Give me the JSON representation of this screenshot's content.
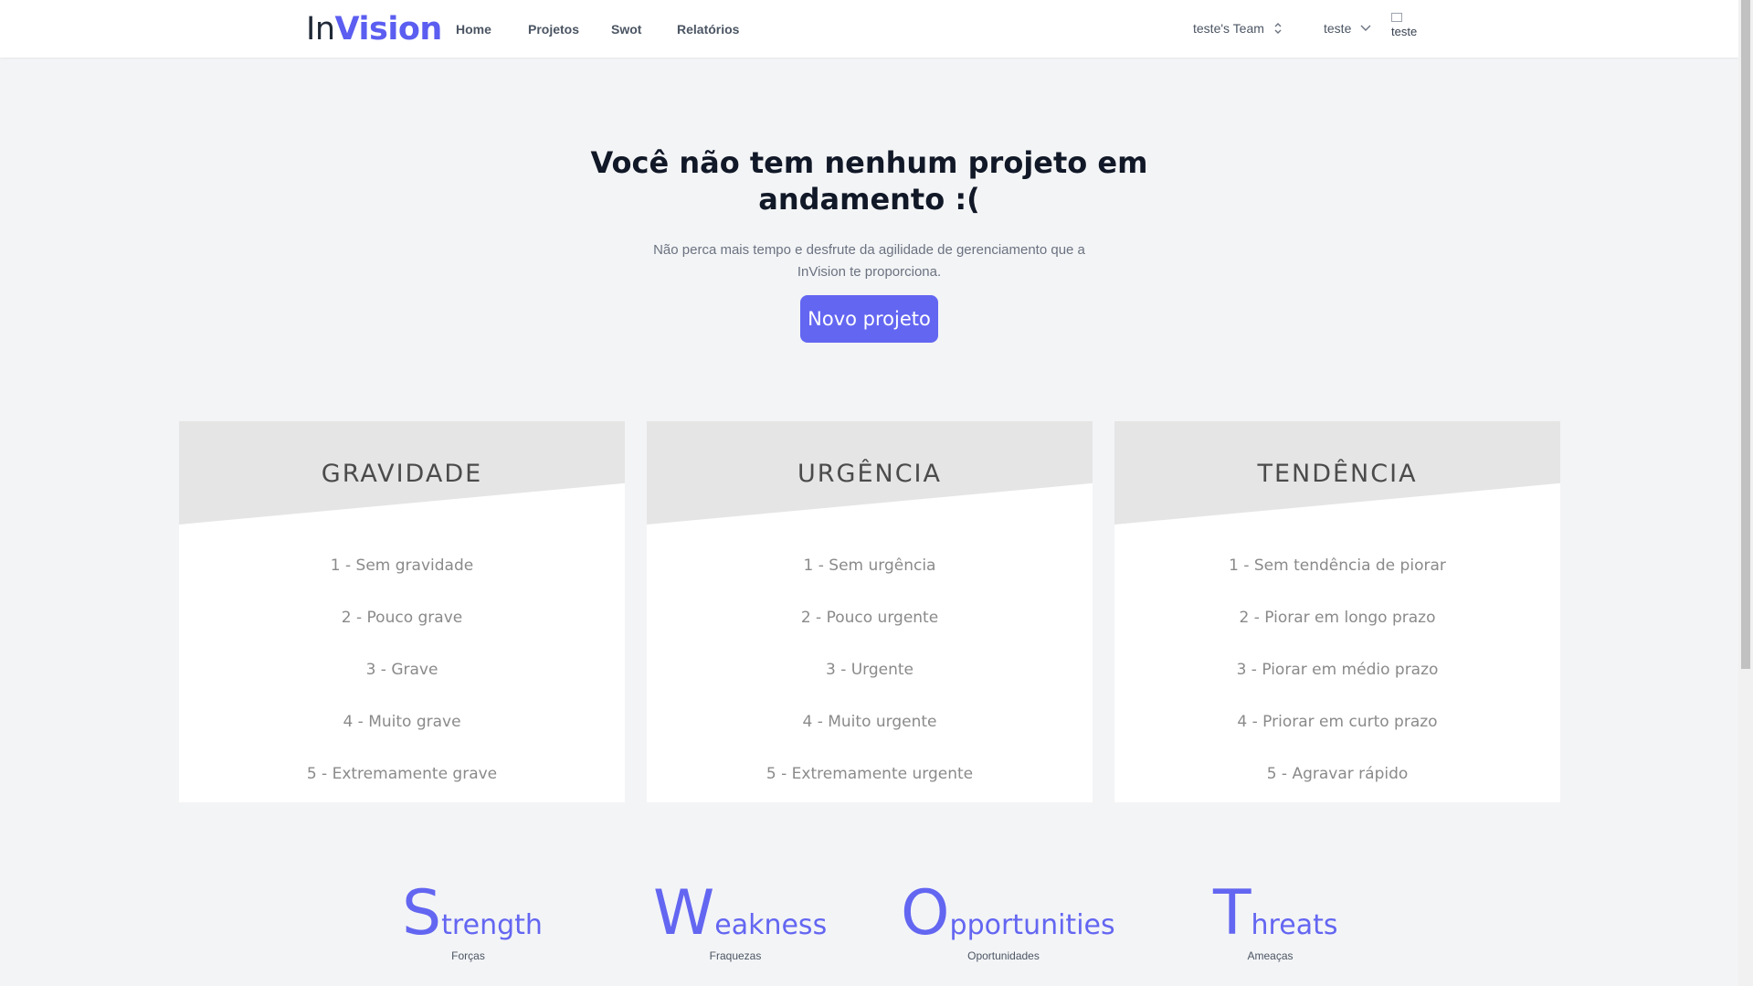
{
  "nav": {
    "logo_plain": "In",
    "logo_bold": "Vision",
    "links": [
      "Home",
      "Projetos",
      "Swot",
      "Relatórios"
    ],
    "team": "teste's Team",
    "user": "teste",
    "avatar_alt": "teste"
  },
  "hero": {
    "title": "Você não tem nenhum projeto em andamento :(",
    "subtitle": "Não perca mais tempo e desfrute da agilidade de gerenciamento que a InVision te proporciona.",
    "button": "Novo projeto"
  },
  "cards": [
    {
      "title": "GRAVIDADE",
      "items": [
        "1 - Sem gravidade",
        "2 - Pouco grave",
        "3 - Grave",
        "4 - Muito grave",
        "5 - Extremamente grave"
      ]
    },
    {
      "title": "URGÊNCIA",
      "items": [
        "1 - Sem urgência",
        "2 - Pouco urgente",
        "3 - Urgente",
        "4 - Muito urgente",
        "5 - Extremamente urgente"
      ]
    },
    {
      "title": "TENDÊNCIA",
      "items": [
        "1 - Sem tendência de piorar",
        "2 - Piorar em longo prazo",
        "3 - Piorar em médio prazo",
        "4 - Priorar em curto prazo",
        "5 - Agravar rápido"
      ]
    }
  ],
  "swot": [
    {
      "initial": "S",
      "rest": "trength",
      "sub": "Forças"
    },
    {
      "initial": "W",
      "rest": "eakness",
      "sub": "Fraquezas"
    },
    {
      "initial": "O",
      "rest": "pportunities",
      "sub": "Oportunidades"
    },
    {
      "initial": "T",
      "rest": "hreats",
      "sub": "Ameaças"
    }
  ],
  "colors": {
    "accent": "#6366f1",
    "card_head": "#e5e5e5",
    "background": "#f3f4f6"
  }
}
